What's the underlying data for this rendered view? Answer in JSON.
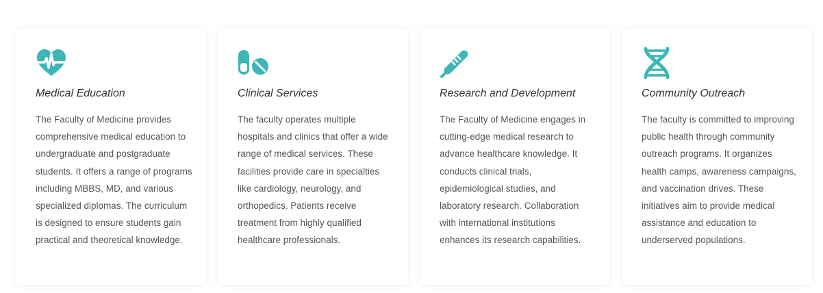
{
  "colors": {
    "accent": "#3db6b8",
    "title": "#333333",
    "text": "#555555"
  },
  "cards": [
    {
      "icon": "heart-pulse-icon",
      "title": "Medical Education",
      "text": "The Faculty of Medicine provides comprehensive medical education to undergraduate and postgraduate students. It offers a range of programs including MBBS, MD, and various specialized diplomas. The curriculum is designed to ensure students gain practical and theoretical knowledge."
    },
    {
      "icon": "pills-icon",
      "title": "Clinical Services",
      "text": "The faculty operates multiple hospitals and clinics that offer a wide range of medical services. These facilities provide care in specialties like cardiology, neurology, and orthopedics. Patients receive treatment from highly qualified healthcare professionals."
    },
    {
      "icon": "thermometer-icon",
      "title": "Research and Development",
      "text": "The Faculty of Medicine engages in cutting-edge medical research to advance healthcare knowledge. It conducts clinical trials, epidemiological studies, and laboratory research. Collaboration with international institutions enhances its research capabilities."
    },
    {
      "icon": "dna-icon",
      "title": "Community Outreach",
      "text": "The faculty is committed to improving public health through community outreach programs. It organizes health camps, awareness campaigns, and vaccination drives. These initiatives aim to provide medical assistance and education to underserved populations."
    }
  ]
}
